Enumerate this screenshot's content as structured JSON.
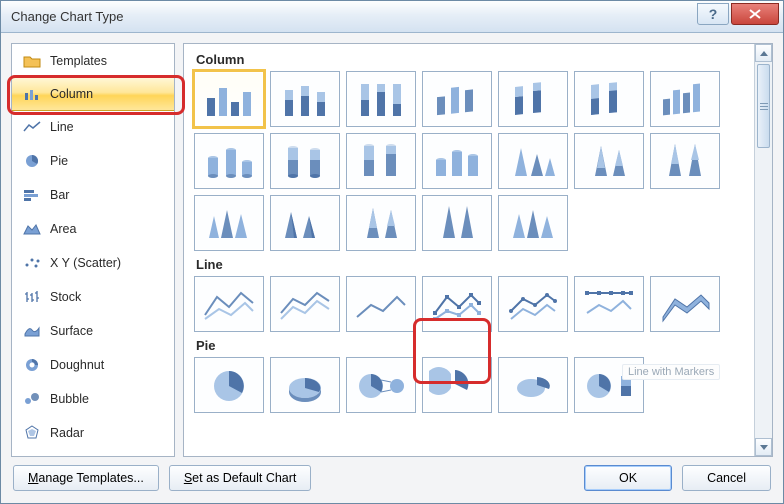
{
  "title": "Change Chart Type",
  "sidebar": {
    "items": [
      {
        "label": "Templates",
        "icon": "folder-icon"
      },
      {
        "label": "Column",
        "icon": "column-icon",
        "selected": true
      },
      {
        "label": "Line",
        "icon": "line-icon"
      },
      {
        "label": "Pie",
        "icon": "pie-icon"
      },
      {
        "label": "Bar",
        "icon": "bar-icon"
      },
      {
        "label": "Area",
        "icon": "area-icon"
      },
      {
        "label": "X Y (Scatter)",
        "icon": "scatter-icon"
      },
      {
        "label": "Stock",
        "icon": "stock-icon"
      },
      {
        "label": "Surface",
        "icon": "surface-icon"
      },
      {
        "label": "Doughnut",
        "icon": "doughnut-icon"
      },
      {
        "label": "Bubble",
        "icon": "bubble-icon"
      },
      {
        "label": "Radar",
        "icon": "radar-icon"
      }
    ]
  },
  "sections": {
    "column": "Column",
    "line": "Line",
    "pie": "Pie"
  },
  "tooltip": "Line with Markers",
  "footer": {
    "manage": "Manage Templates...",
    "default": "Set as Default Chart",
    "ok": "OK",
    "cancel": "Cancel"
  },
  "colors": {
    "accent_blue": "#5a8bd0",
    "highlight_red": "#d62c2c",
    "selection_gold": "#f2c34a"
  }
}
